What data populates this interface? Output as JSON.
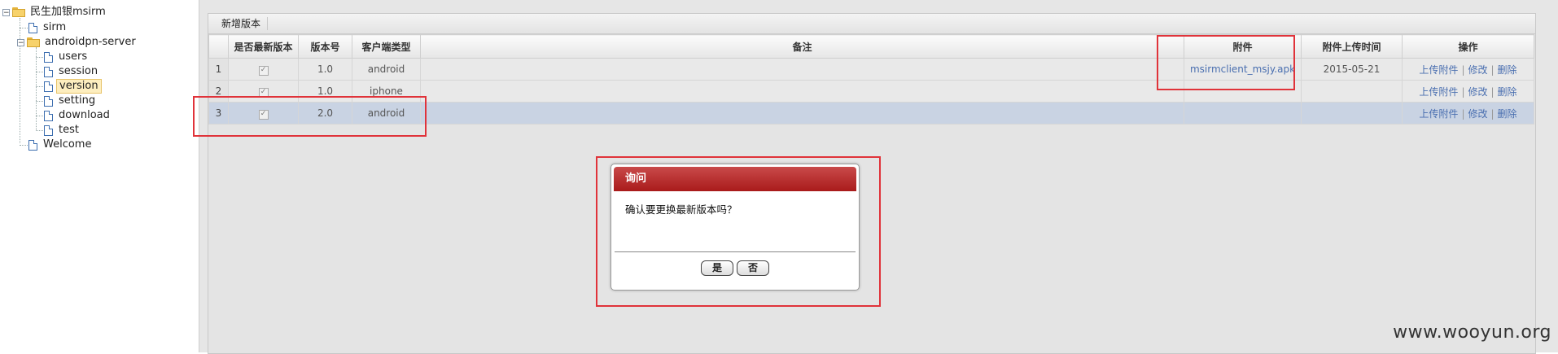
{
  "tree": {
    "root": "民生加银msirm",
    "sirm": "sirm",
    "server": "androidpn-server",
    "children": [
      "users",
      "session",
      "version",
      "setting",
      "download",
      "test"
    ],
    "welcome": "Welcome",
    "selected": "version"
  },
  "toolbar": {
    "add_version": "新增版本"
  },
  "grid": {
    "columns": [
      "是否最新版本",
      "版本号",
      "客户端类型",
      "备注",
      "附件",
      "附件上传时间",
      "操作"
    ],
    "rows": [
      {
        "num": "1",
        "latest": true,
        "version": "1.0",
        "client": "android",
        "remark": "",
        "attachment": "msirmclient_msjy.apk",
        "upload_time": "2015-05-21"
      },
      {
        "num": "2",
        "latest": true,
        "version": "1.0",
        "client": "iphone",
        "remark": "",
        "attachment": "",
        "upload_time": ""
      },
      {
        "num": "3",
        "latest": true,
        "version": "2.0",
        "client": "android",
        "remark": "",
        "attachment": "",
        "upload_time": ""
      }
    ],
    "actions": {
      "upload": "上传附件",
      "edit": "修改",
      "delete": "删除",
      "sep": "|"
    },
    "selected_row": 3
  },
  "dialog": {
    "title": "询问",
    "message": "确认要更换最新版本吗？",
    "yes": "是",
    "no": "否"
  },
  "watermark": "www.wooyun.org",
  "colors": {
    "highlight": "#e0333a",
    "dialog_title": "#b52a2a",
    "link": "#4a6fb0"
  }
}
